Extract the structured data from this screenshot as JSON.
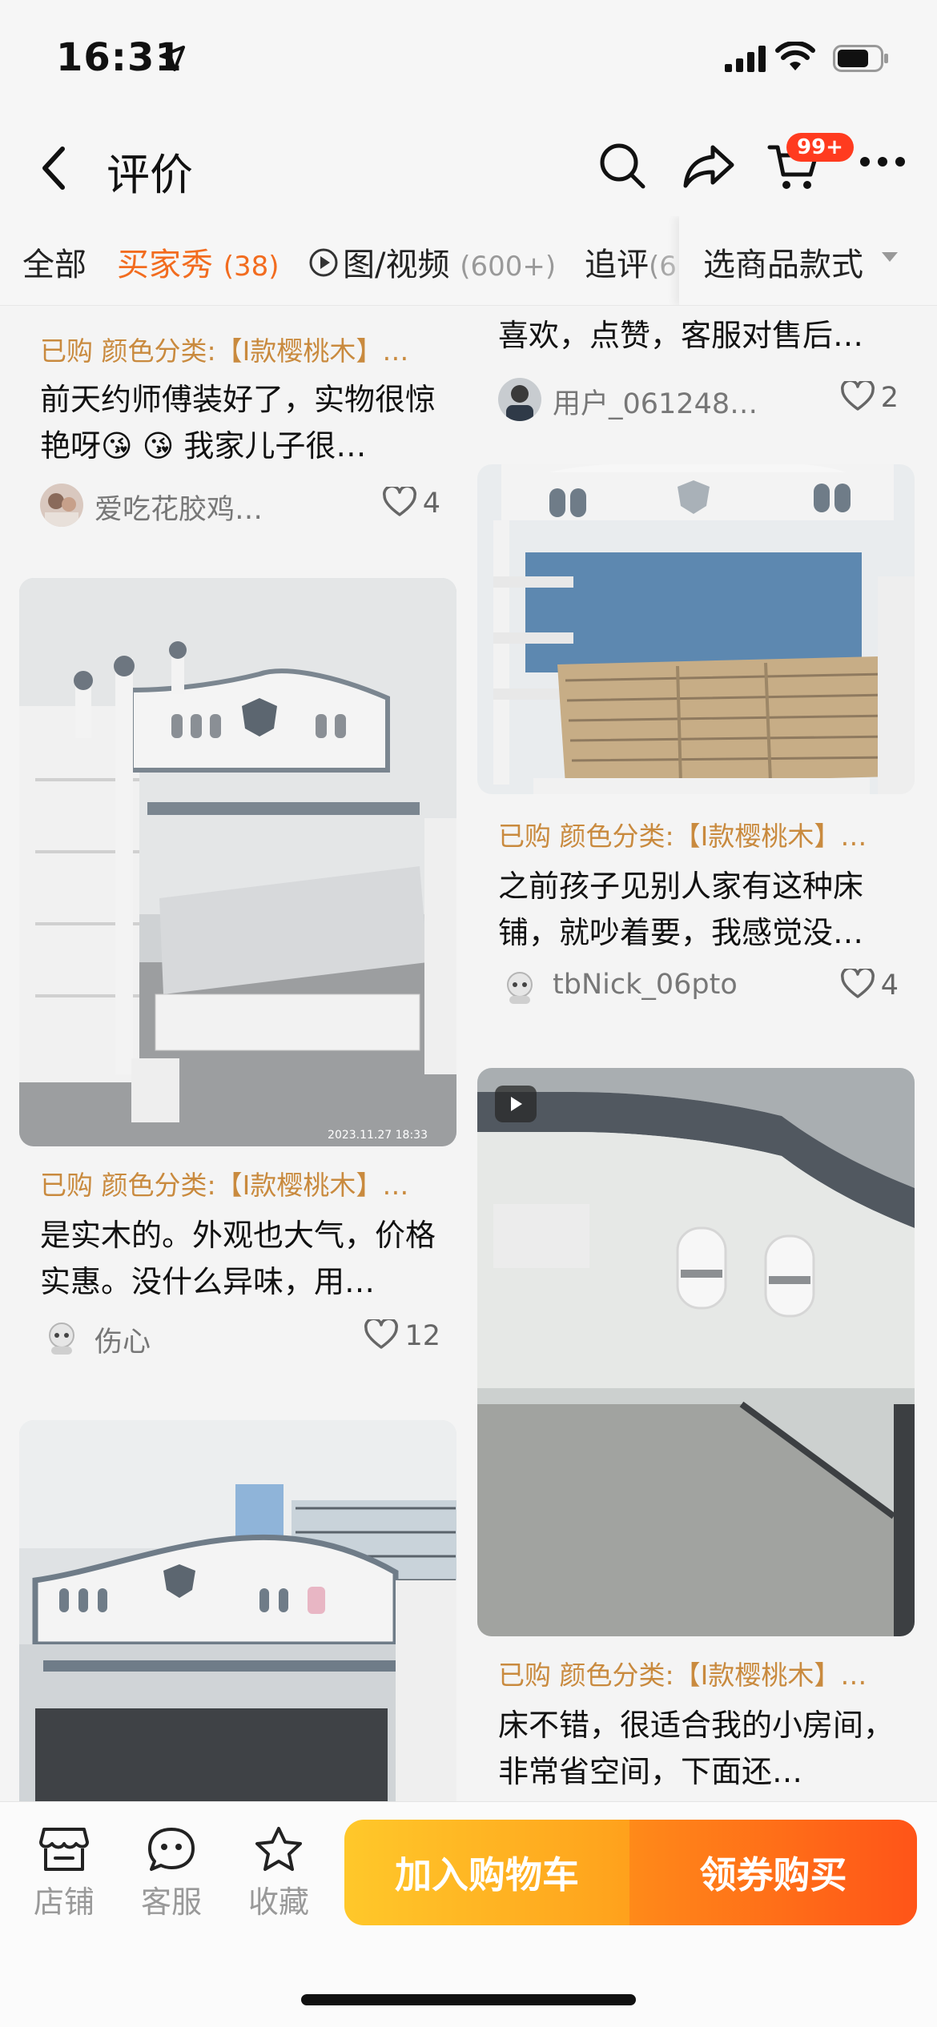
{
  "status_bar": {
    "time": "16:31"
  },
  "header": {
    "title": "评价",
    "cart_badge": "99+"
  },
  "tabs": [
    {
      "label": "全部",
      "count": ""
    },
    {
      "label": "买家秀",
      "count": "(38)"
    },
    {
      "label": "图/视频",
      "count": "(600+)"
    },
    {
      "label": "追评",
      "count": "(6"
    }
  ],
  "style_selector": {
    "label": "选商品款式"
  },
  "reviews": [
    {
      "spec": "已购 颜色分类:【I款樱桃木】…",
      "text": "前天约师傅装好了，实物很惊艳呀😘 😘 我家儿子很…",
      "user": "爱吃花胶鸡…",
      "likes": "4"
    },
    {
      "spec": "",
      "text": "喜欢，点赞，客服对售后…",
      "user": "用户_061248…",
      "likes": "2"
    },
    {
      "spec": "已购 颜色分类:【I款樱桃木】…",
      "text": "是实木的。外观也大气，价格实惠。没什么异味，用…",
      "user": "伤心",
      "likes": "12",
      "photo_time": "2023.11.27  18:33"
    },
    {
      "spec": "已购 颜色分类:【I款樱桃木】…",
      "text": "之前孩子见别人家有这种床铺，就吵着要，我感觉没…",
      "user": "tbNick_06pto",
      "likes": "4"
    },
    {
      "spec": "已购 颜色分类:【I款樱桃木】…",
      "text": "床不错，很适合我的小房间，非常省空间，下面还…",
      "user": "",
      "likes": ""
    }
  ],
  "bottom_bar": {
    "store": "店铺",
    "service": "客服",
    "favorite": "收藏",
    "add_cart": "加入购物车",
    "buy": "领券购买"
  },
  "colors": {
    "accent": "#f26c1f",
    "spec": "#c98a3e",
    "cart_btn": "#ffb321",
    "buy_btn": "#ff6a18",
    "badge": "#ff3b1f"
  }
}
